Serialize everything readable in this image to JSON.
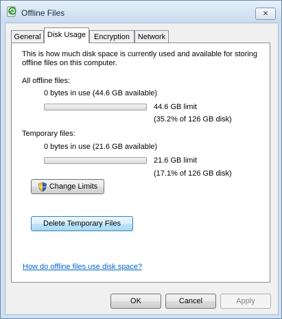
{
  "window": {
    "title": "Offline Files",
    "close_glyph": "✕"
  },
  "tabs": [
    {
      "label": "General"
    },
    {
      "label": "Disk Usage",
      "active": true
    },
    {
      "label": "Encryption"
    },
    {
      "label": "Network"
    }
  ],
  "panel": {
    "intro": [
      "This is how much disk space is currently used and available for storing",
      "offline files on this computer."
    ],
    "all_files": {
      "heading": "All offline files:",
      "usage": "0 bytes in use (44.6 GB available)",
      "used_fraction": 0,
      "limit": "44.6 GB limit",
      "percent": "(35.2% of 126 GB disk)"
    },
    "temp_files": {
      "heading": "Temporary files:",
      "usage": "0 bytes in use (21.6 GB available)",
      "used_fraction": 0,
      "limit": "21.6 GB limit",
      "percent": "(17.1% of 126 GB disk)"
    },
    "change_limits_button": "Change Limits",
    "delete_temp_button": "Delete Temporary Files",
    "help_link": "How do offline files use disk space?"
  },
  "footer": {
    "ok": "OK",
    "cancel": "Cancel",
    "apply": "Apply"
  },
  "icons": {
    "app": "offline-files-icon",
    "shield": "uac-shield-icon",
    "close": "close-icon"
  }
}
